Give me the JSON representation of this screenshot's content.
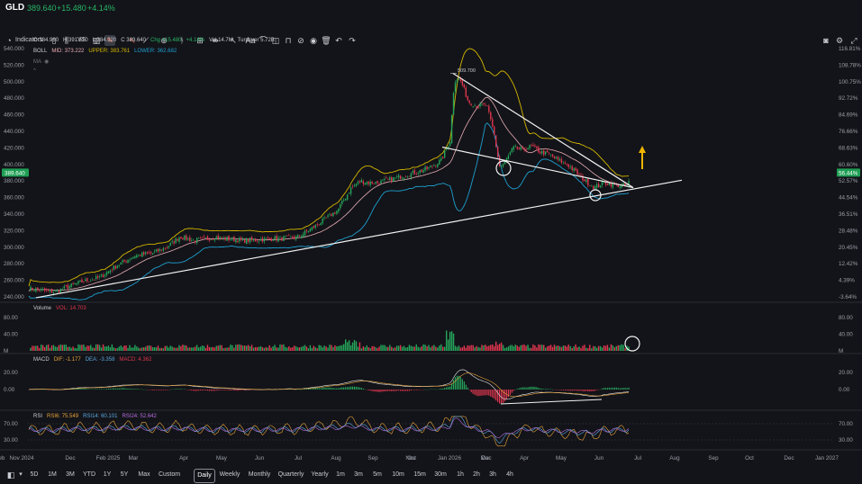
{
  "header": {
    "symbol": "GLD",
    "price": "389.640",
    "change": "+15.480",
    "change_pct": "+4.14%"
  },
  "toolbar": {
    "indicators_label": "Indicators",
    "vs_label": "VS"
  },
  "ohlc": {
    "open": "O 384.960",
    "high": "H 391.510",
    "low": "L 384.320",
    "close": "C 389.640",
    "chg": "Chg +15.480",
    "chg_pct": "+4.14%",
    "vol": "Vol 14.7M",
    "turnover": "Turnover 5.72B"
  },
  "boll": {
    "label": "BOLL",
    "mid": "MID: 373.222",
    "upper": "UPPER: 383.761",
    "lower": "LOWER: 362.682"
  },
  "ma_label": "MA",
  "volume": {
    "label": "Volume",
    "value": "VOL: 14.703"
  },
  "macd": {
    "label": "MACD",
    "dif": "DIF: -1.177",
    "dea": "DEA: -3.358",
    "macd": "MACD: 4.362"
  },
  "rsi": {
    "label": "RSI",
    "rsi6": "RSI6: 75.549",
    "rsi14": "RSI14: 60.101",
    "rsi24": "RSI24: 52.642"
  },
  "axes": {
    "price_ticks": [
      "540.000",
      "520.000",
      "500.000",
      "480.000",
      "460.000",
      "440.000",
      "420.000",
      "400.000",
      "380.000",
      "360.000",
      "340.000",
      "320.000",
      "300.000",
      "280.000",
      "260.000",
      "240.000"
    ],
    "pct_ticks": [
      "116.81%",
      "108.78%",
      "100.75%",
      "92.72%",
      "84.69%",
      "76.66%",
      "68.63%",
      "60.60%",
      "52.57%",
      "44.54%",
      "36.51%",
      "28.48%",
      "20.45%",
      "12.42%",
      "4.39%",
      "-3.64%"
    ],
    "price_tag": "389.640",
    "pct_tag": "56.44%",
    "peak_label": "509.700",
    "vol_ticks": [
      "80.00",
      "40.00",
      "M"
    ],
    "vol_ticks_right": [
      "80.00",
      "40.00",
      "M"
    ],
    "macd_ticks": [
      "20.00",
      "0.00"
    ],
    "rsi_ticks": [
      "70.00",
      "30.00"
    ],
    "months": [
      "Nov 2024",
      "Dec",
      "Feb 2025",
      "Mar",
      "Apr",
      "May",
      "Jun",
      "Jul",
      "Aug",
      "Sep",
      "Oct",
      "Nov",
      "Dec",
      "Jan 2026",
      "Feb",
      "Mar",
      "Apr",
      "May",
      "Jun",
      "Jul",
      "Aug",
      "Sep",
      "Oct",
      "Dec",
      "Jan 2027",
      "Feb"
    ]
  },
  "timeframes": [
    "5D",
    "1M",
    "3M",
    "YTD",
    "1Y",
    "5Y",
    "Max",
    "Custom"
  ],
  "intervals": [
    "Daily",
    "Weekly",
    "Monthly",
    "Quarterly",
    "Yearly",
    "1m",
    "3m",
    "5m",
    "10m",
    "15m",
    "30m",
    "1h",
    "2h",
    "3h",
    "4h"
  ],
  "active_interval": "Daily",
  "colors": {
    "bg": "#131419",
    "up": "#26a65b",
    "down": "#e0364f",
    "mid": "#e9aeb5",
    "upper": "#d4b600",
    "lower": "#1e9fd0",
    "accent": "#f0b400"
  }
}
